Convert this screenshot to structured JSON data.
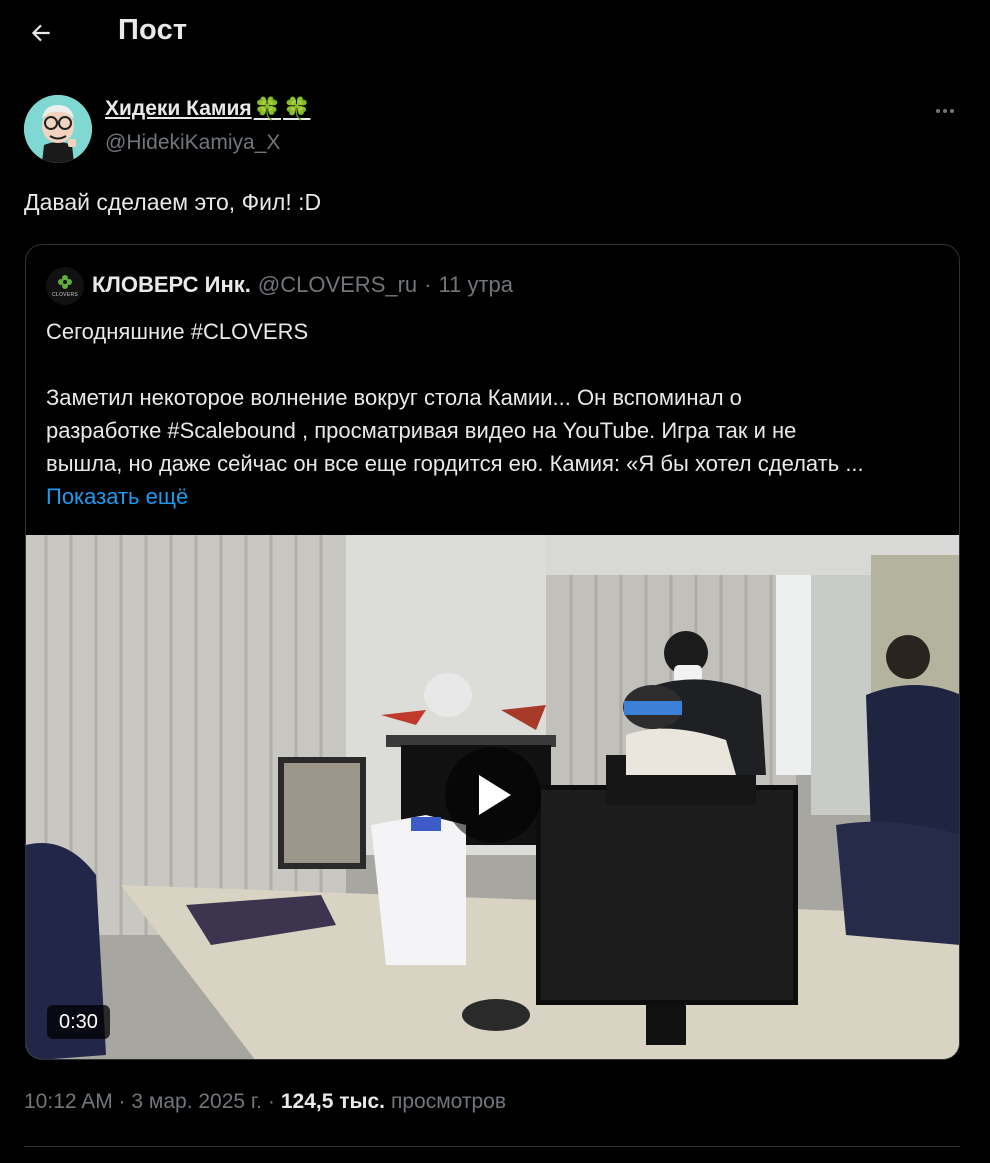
{
  "header": {
    "title": "Пост",
    "back_icon": "arrow-left-icon"
  },
  "tweet": {
    "author_name": "Хидеки Камия",
    "author_emoji": [
      "🍀",
      "🍀"
    ],
    "author_handle": "@HidekiKamiya_X",
    "text": "Давай сделаем это, Фил! :D",
    "more_icon": "more-horizontal-icon",
    "timestamp": "10:12 AM · 3 мар. 2025 г.",
    "separator": "·",
    "views_count": "124,5 тыс.",
    "views_label": "просмотров"
  },
  "quote": {
    "name": "КЛОВЕРС Инк.",
    "handle": "@CLOVERS_ru",
    "dot": "·",
    "time": "11 утра",
    "avatar_word": "CLOVERS",
    "line1": "Сегодняшние #CLOVERS",
    "line2": "Заметил некоторое волнение вокруг стола Камии... Он вспоминал о",
    "line3": "разработке #Scalebound , просматривая видео на YouTube. Игра так и не",
    "line4": "вышла, но даже сейчас он все еще гордится ею. Камия: «Я бы хотел сделать ...",
    "show_more": "Показать ещё",
    "video": {
      "duration": "0:30",
      "play_icon": "play-icon"
    }
  },
  "colors": {
    "background": "#000000",
    "text": "#e7e9ea",
    "secondary": "#71767b",
    "link": "#1d9bf0",
    "border": "#2f3336",
    "clover": "#3cb043"
  }
}
